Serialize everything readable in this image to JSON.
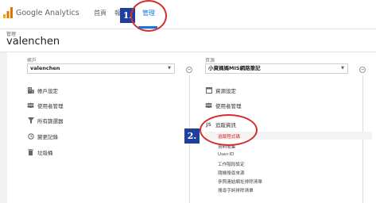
{
  "brand": {
    "name": "Google Analytics"
  },
  "nav": {
    "home": "首頁",
    "reports": "報表",
    "admin": "管理"
  },
  "page": {
    "subtitle": "管理",
    "title": "valenchen"
  },
  "account": {
    "label": "帳戶",
    "selected": "valenchen",
    "items": [
      {
        "label": "帳戶設定",
        "icon": "building-icon"
      },
      {
        "label": "使用者管理",
        "icon": "people-icon"
      },
      {
        "label": "所有篩選器",
        "icon": "filter-icon"
      },
      {
        "label": "變更記錄",
        "icon": "history-icon"
      },
      {
        "label": "垃圾桶",
        "icon": "trash-icon"
      }
    ]
  },
  "property": {
    "label": "資源",
    "selected": "小資媽媽MIS網路筆記",
    "items": [
      {
        "label": "資源設定",
        "icon": "window-icon"
      },
      {
        "label": "使用者管理",
        "icon": "people-icon"
      },
      {
        "label": "追蹤資訊",
        "icon": "js-icon"
      }
    ],
    "tracking_sub": [
      {
        "label": "追蹤程式碼",
        "active": true
      },
      {
        "label": "資料收集",
        "active": false
      },
      {
        "label": "User-ID",
        "active": false
      },
      {
        "label": "工作階段設定",
        "active": false
      },
      {
        "label": "隨機搜尋來源",
        "active": false
      },
      {
        "label": "參照連結網址排除清單",
        "active": false
      },
      {
        "label": "搜尋字詞排除清單",
        "active": false
      }
    ]
  },
  "annotations": {
    "step1": "1.",
    "step2": "2.",
    "ring_color": "#d32f2f",
    "badge_color": "#1e3f9b"
  },
  "colors": {
    "accent": "#1a73e8",
    "active_sub": "#e2231a"
  }
}
